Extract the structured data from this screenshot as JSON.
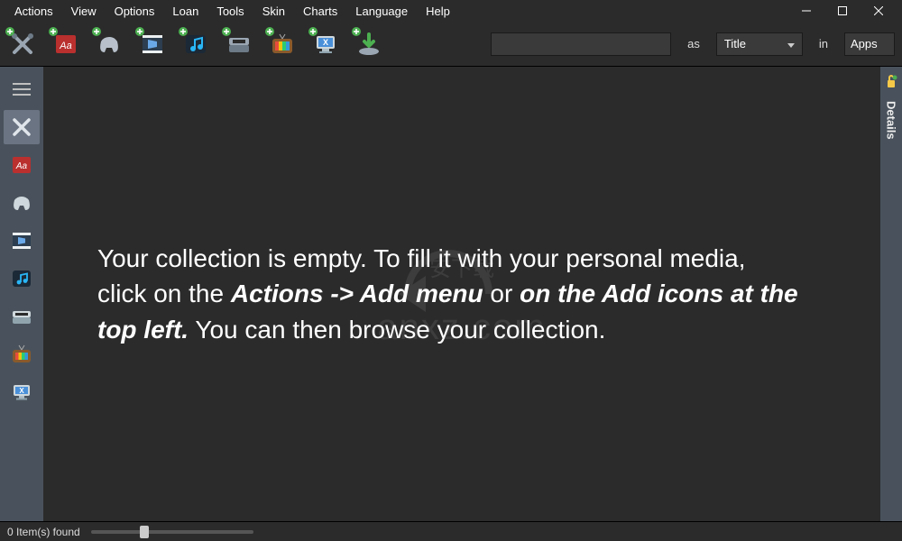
{
  "menu": {
    "items": [
      "Actions",
      "View",
      "Options",
      "Loan",
      "Tools",
      "Skin",
      "Charts",
      "Language",
      "Help"
    ]
  },
  "toolbar": {
    "icons": [
      {
        "name": "add-tools-icon"
      },
      {
        "name": "add-book-icon"
      },
      {
        "name": "add-game-icon"
      },
      {
        "name": "add-video-icon"
      },
      {
        "name": "add-music-icon"
      },
      {
        "name": "add-handheld-icon"
      },
      {
        "name": "add-tv-icon"
      },
      {
        "name": "add-mac-icon"
      },
      {
        "name": "add-download-icon"
      }
    ],
    "as_label": "as",
    "in_label": "in",
    "field_dropdown": "Title",
    "in_value": "Apps",
    "search_value": ""
  },
  "sidebar": {
    "items": [
      {
        "name": "hamburger-icon"
      },
      {
        "name": "tools-icon",
        "active": true
      },
      {
        "name": "book-icon"
      },
      {
        "name": "game-icon"
      },
      {
        "name": "video-icon"
      },
      {
        "name": "music-icon"
      },
      {
        "name": "handheld-icon"
      },
      {
        "name": "tv-icon"
      },
      {
        "name": "mac-icon"
      }
    ]
  },
  "details": {
    "tab_label": "Details"
  },
  "content": {
    "msg_part1": "Your collection is empty. To fill it with your personal media, click on the ",
    "msg_em1": "Actions -> Add menu",
    "msg_part2": " or ",
    "msg_em2": "on the Add icons at the top left.",
    "msg_part3": " You can then browse your collection."
  },
  "watermark": {
    "text": "anxz.com",
    "sub": "安下载"
  },
  "statusbar": {
    "items_found": "0 Item(s) found"
  }
}
